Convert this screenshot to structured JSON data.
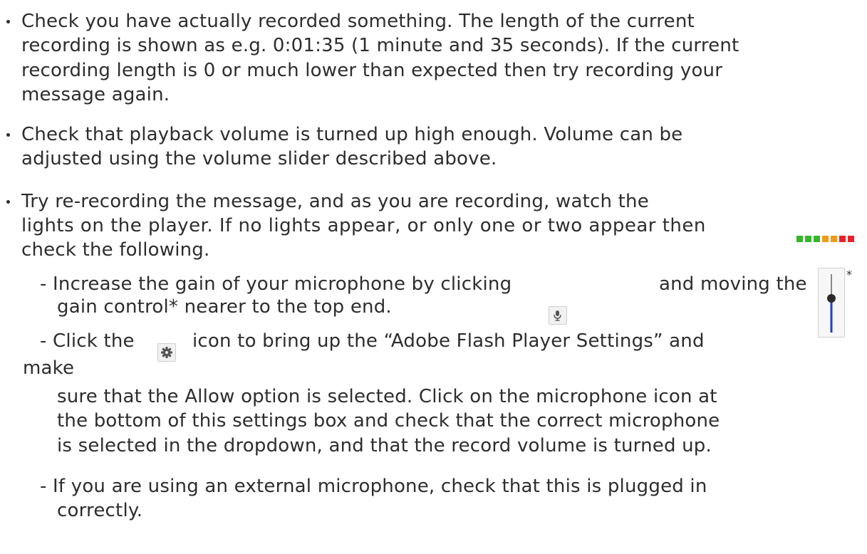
{
  "bullets": {
    "b1": {
      "l1": "Check you have actually recorded something. The length of the current",
      "l2": "recording is shown as e.g. 0:01:35 (1 minute and 35 seconds). If the current",
      "l3": "recording length is 0 or much lower than expected then try recording your",
      "l4": "message again."
    },
    "b2": {
      "l1": "Check that playback volume is turned up high enough. Volume can be",
      "l2": "adjusted using the volume slider described above."
    },
    "b3": {
      "l1": "Try re-recording the message, and as you are recording, watch the",
      "l2": "lights on the player. If no lights appear, or only one or two appear then",
      "l3": "check the following."
    }
  },
  "sub": {
    "gain": {
      "l1a": "- Increase the gain of your microphone by clicking",
      "l1b": "and moving the",
      "l2": "gain control* nearer to the top end."
    },
    "settings": {
      "l1a": "- Click the",
      "l1b": "icon to bring up the “Adobe Flash Player Settings” and",
      "l2": "make",
      "l3": "sure that the Allow option is selected. Click on the microphone icon at",
      "l4": "the bottom of this settings box and check that the correct microphone",
      "l5": "is selected in the dropdown, and that the record volume is turned up."
    },
    "external": {
      "l1": "- If you are using an external microphone, check that this is plugged in",
      "l2": "correctly."
    }
  },
  "asterisk": "*",
  "level_lights": [
    "#35b62b",
    "#35b62b",
    "#35b62b",
    "#f29a1a",
    "#f29a1a",
    "#e8222b",
    "#e8222b"
  ],
  "icons": {
    "microphone": "microphone-icon",
    "settings": "gear-icon",
    "gain_slider": "gain-slider-icon",
    "level_lights": "level-lights-icon"
  }
}
